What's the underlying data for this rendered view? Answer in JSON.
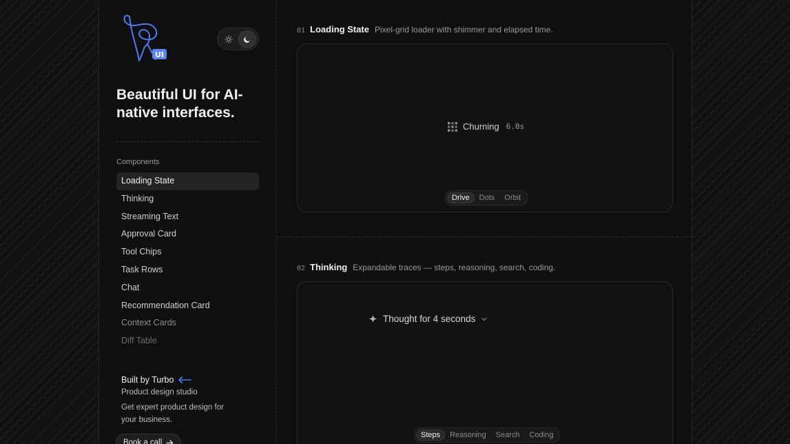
{
  "sidebar": {
    "logo_badge": "UI",
    "headline": "Beautiful UI for AI-native interfaces.",
    "section_label": "Components",
    "items": [
      {
        "label": "Loading State",
        "state": "active"
      },
      {
        "label": "Thinking",
        "state": ""
      },
      {
        "label": "Streaming Text",
        "state": ""
      },
      {
        "label": "Approval Card",
        "state": ""
      },
      {
        "label": "Tool Chips",
        "state": ""
      },
      {
        "label": "Task Rows",
        "state": ""
      },
      {
        "label": "Chat",
        "state": ""
      },
      {
        "label": "Recommendation Card",
        "state": ""
      },
      {
        "label": "Context Cards",
        "state": "fade1"
      },
      {
        "label": "Diff Table",
        "state": "fade2"
      },
      {
        "label": "",
        "state": "fade3"
      }
    ],
    "promo": {
      "title": "Built by Turbo",
      "subtitle": "Product design studio",
      "description": "Get expert product design for your business.",
      "cta": "Book a call"
    }
  },
  "sections": [
    {
      "number": "01",
      "title": "Loading State",
      "description": "Pixel-grid loader with shimmer and elapsed time.",
      "status_text": "Churning",
      "elapsed": "6.0s",
      "tabs": [
        {
          "label": "Drive",
          "selected": true
        },
        {
          "label": "Dots",
          "selected": false
        },
        {
          "label": "Orbit",
          "selected": false
        }
      ]
    },
    {
      "number": "02",
      "title": "Thinking",
      "description": "Expandable traces — steps, reasoning, search, coding.",
      "thought_text": "Thought for 4 seconds",
      "tabs": [
        {
          "label": "Steps",
          "selected": true
        },
        {
          "label": "Reasoning",
          "selected": false
        },
        {
          "label": "Search",
          "selected": false
        },
        {
          "label": "Coding",
          "selected": false
        }
      ]
    }
  ],
  "colors": {
    "accent": "#4d7cf5",
    "background": "#0f0f0f"
  }
}
